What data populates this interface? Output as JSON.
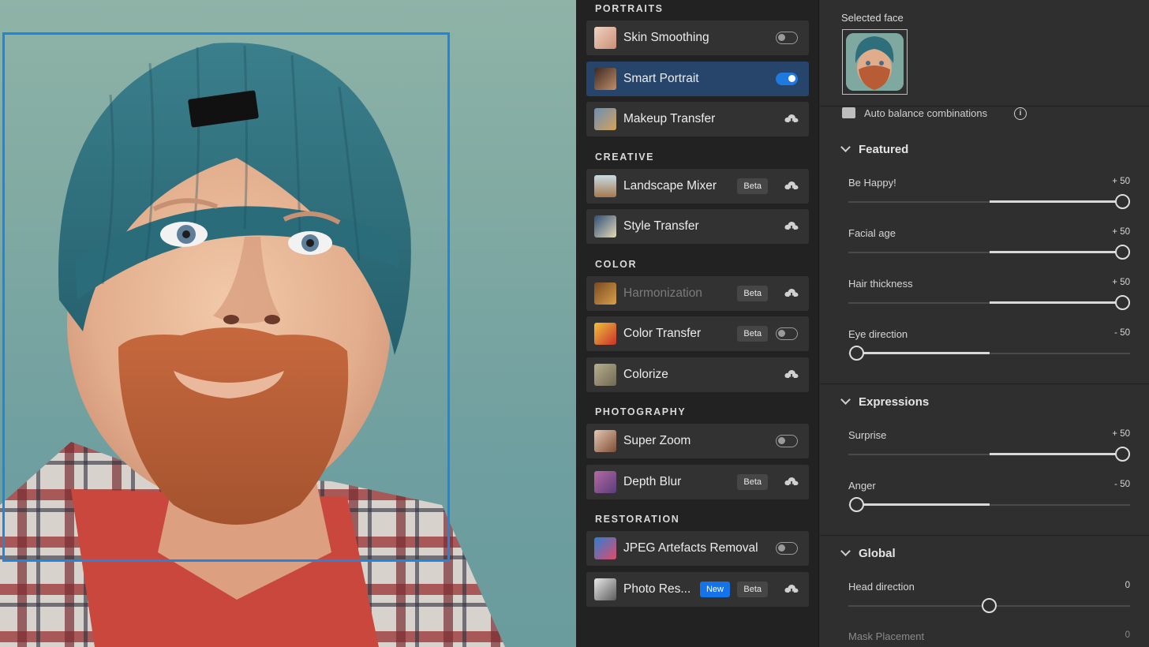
{
  "selected_face": {
    "label": "Selected face"
  },
  "filters": {
    "sections": [
      {
        "title": "PORTRAITS",
        "items": [
          {
            "label": "Skin Smoothing",
            "control": "toggle",
            "on": false,
            "icon": "skin-smoothing-thumbnail"
          },
          {
            "label": "Smart Portrait",
            "control": "toggle",
            "on": true,
            "selected": true,
            "icon": "smart-portrait-thumbnail"
          },
          {
            "label": "Makeup Transfer",
            "control": "cloud-download",
            "icon": "makeup-transfer-thumbnail"
          }
        ]
      },
      {
        "title": "CREATIVE",
        "items": [
          {
            "label": "Landscape Mixer",
            "badges": [
              "Beta"
            ],
            "control": "cloud-download",
            "icon": "landscape-mixer-thumbnail"
          },
          {
            "label": "Style Transfer",
            "control": "cloud-download",
            "icon": "style-transfer-thumbnail"
          }
        ]
      },
      {
        "title": "COLOR",
        "items": [
          {
            "label": "Harmonization",
            "badges": [
              "Beta"
            ],
            "control": "cloud-download",
            "disabled": true,
            "icon": "harmonization-thumbnail"
          },
          {
            "label": "Color Transfer",
            "badges": [
              "Beta"
            ],
            "control": "toggle",
            "on": false,
            "icon": "color-transfer-thumbnail"
          },
          {
            "label": "Colorize",
            "control": "cloud-download",
            "icon": "colorize-thumbnail"
          }
        ]
      },
      {
        "title": "PHOTOGRAPHY",
        "items": [
          {
            "label": "Super Zoom",
            "control": "toggle",
            "on": false,
            "icon": "super-zoom-thumbnail"
          },
          {
            "label": "Depth Blur",
            "badges": [
              "Beta"
            ],
            "control": "cloud-download",
            "icon": "depth-blur-thumbnail"
          }
        ]
      },
      {
        "title": "RESTORATION",
        "items": [
          {
            "label": "JPEG Artefacts Removal",
            "control": "toggle",
            "on": false,
            "icon": "jpeg-artefacts-thumbnail"
          },
          {
            "label": "Photo Res...",
            "badges": [
              "New",
              "Beta"
            ],
            "control": "cloud-download",
            "icon": "photo-restoration-thumbnail"
          }
        ]
      }
    ]
  },
  "panel": {
    "auto_balance": {
      "label": "Auto balance combinations",
      "checked": true,
      "info_glyph": "i"
    },
    "groups": [
      {
        "title": "Featured",
        "sliders": [
          {
            "name": "Be Happy!",
            "value_text": "+ 50",
            "value": 50
          },
          {
            "name": "Facial age",
            "value_text": "+ 50",
            "value": 50
          },
          {
            "name": "Hair thickness",
            "value_text": "+ 50",
            "value": 50
          },
          {
            "name": "Eye direction",
            "value_text": "- 50",
            "value": -50
          }
        ]
      },
      {
        "title": "Expressions",
        "sliders": [
          {
            "name": "Surprise",
            "value_text": "+ 50",
            "value": 50
          },
          {
            "name": "Anger",
            "value_text": "- 50",
            "value": -50
          }
        ]
      },
      {
        "title": "Global",
        "sliders": [
          {
            "name": "Head direction",
            "value_text": "0",
            "value": 0
          }
        ]
      }
    ],
    "mask_placement": {
      "name": "Mask Placement",
      "value_text": "0"
    }
  },
  "colors": {
    "accent": "#1473e6",
    "face_box": "#1f86e0",
    "selected_row": "#27456a",
    "panel_bg": "#2f2f2f",
    "list_bg": "#222222"
  }
}
